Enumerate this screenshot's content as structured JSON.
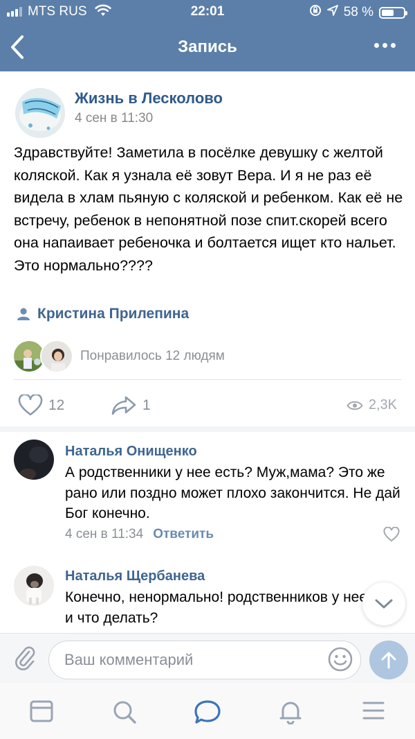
{
  "status_bar": {
    "carrier": "MTS RUS",
    "time": "22:01",
    "battery_percent": "58 %",
    "battery_level": 0.58
  },
  "nav": {
    "title": "Запись",
    "back_icon": "chevron-left-icon",
    "more_icon": "more-dots-icon"
  },
  "post": {
    "group_name": "Жизнь в Лесколово",
    "date": "4 сен в 11:30",
    "text": "Здравствуйте! Заметила в посёлке девушку с желтой коляской. Как я узнала её зовут Вера. И я не раз её видела в хлам пьяную с коляской и ребенком. Как её не встречу, ребенок в непонятной позе спит.скорей всего она напаивает ребеночка и болтается ищет кто нальет. Это нормально????",
    "author": "Кристина Прилепина",
    "liked_text": "Понравилось 12 людям",
    "likes": "12",
    "shares": "1",
    "views": "2,3K"
  },
  "comments": [
    {
      "name": "Наталья Онищенко",
      "text": "А родственники у нее есть? Муж,мама? Это же рано или поздно может плохо закончится. Не дай Бог конечно.",
      "date": "4 сен в 11:34",
      "reply": "Ответить"
    },
    {
      "name": "Наталья Щербанева",
      "text": "Конечно, ненормально! родственников у нее нет. и что делать?"
    }
  ],
  "composer": {
    "placeholder": "Ваш комментарий"
  },
  "colors": {
    "header": "#5b7fa8",
    "link": "#3e6591",
    "accent": "#2f5a8a",
    "icon": "#5e82ab"
  }
}
